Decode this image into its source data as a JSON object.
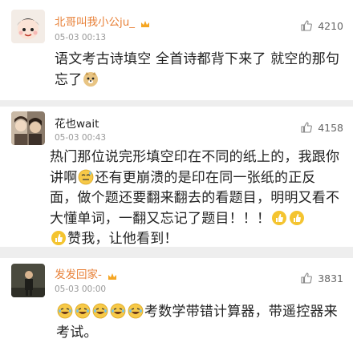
{
  "comments": [
    {
      "username": "北哥叫我小公ju_",
      "time": "05-03 00:13",
      "likes": "4210",
      "text_parts": [
        "语文考古诗填空 全首诗都背下来了 就空的那句忘了"
      ]
    },
    {
      "username": "花也wait",
      "time": "05-03 00:43",
      "likes": "4158",
      "text_parts": [
        "热门那位说完形填空印在不同的纸上的，我跟你讲啊",
        "还有更崩溃的是印在同一张纸的正反面，做个题还要翻来翻去的看题目，明明又看不大懂单词，一翻又忘记了题目！！！",
        "赞我，让他看到！"
      ]
    },
    {
      "username": "发发回家-",
      "time": "05-03 00:00",
      "likes": "3831",
      "text_parts": [
        "考数学带错计算器，带遥控器来考试。"
      ]
    }
  ],
  "icons": {
    "like": "thumbs-up-icon",
    "vip": "crown-badge-icon",
    "emoji_doge": "doge-emoji-icon",
    "emoji_awkward": "awkward-smile-emoji-icon",
    "emoji_thumb": "yellow-thumb-emoji-icon",
    "emoji_laugh": "laugh-cry-emoji-icon"
  },
  "colors": {
    "username_highlight": "#e8823a",
    "username_normal": "#222222",
    "meta_text": "#999999",
    "divider": "#eeeeee"
  }
}
